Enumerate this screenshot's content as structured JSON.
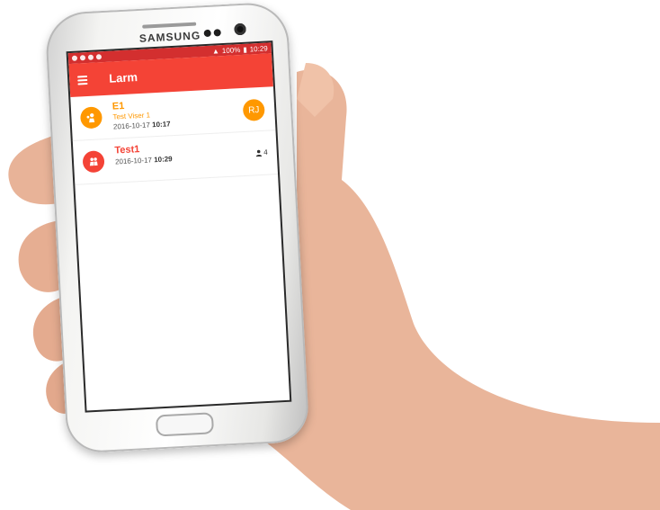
{
  "device": {
    "brand": "SAMSUNG"
  },
  "statusbar": {
    "battery": "100%",
    "time": "10:29"
  },
  "appbar": {
    "title": "Larm"
  },
  "alarms": [
    {
      "title": "E1",
      "subtitle": "Test Viser 1",
      "date": "2016-10-17",
      "time": "10:17",
      "avatar": "RJ",
      "color": "#ff9800",
      "icon": "person-alert-icon"
    },
    {
      "title": "Test1",
      "subtitle": "",
      "date": "2016-10-17",
      "time": "10:29",
      "participants": "4",
      "color": "#f44336",
      "icon": "group-alert-icon"
    }
  ],
  "colors": {
    "appbar": "#f44336",
    "statusbar": "#d32f2f",
    "accent": "#ff9800"
  }
}
